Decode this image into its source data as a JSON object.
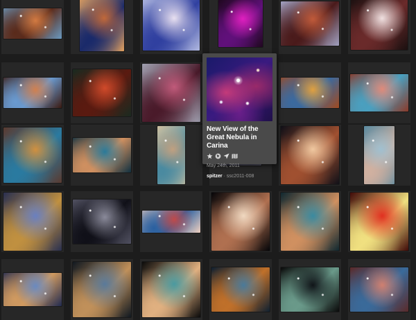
{
  "popup": {
    "title": "New View of the Great Nebula in Carina",
    "date": "May 24th, 2011",
    "source_user": "spitzer",
    "source_sep": " · ",
    "source_id": "ssc2011-008",
    "icons": [
      "star-icon",
      "globe-icon",
      "location-icon",
      "map-icon"
    ]
  },
  "gallery": {
    "rows": [
      [
        {
          "name": "pillars-orange",
          "colors": [
            "#d27a42",
            "#5a2a1a",
            "#6a9ac0"
          ]
        },
        {
          "name": "nebula-cloud-blue-orange",
          "colors": [
            "#c0683a",
            "#1a2a6a",
            "#e0a060"
          ]
        },
        {
          "name": "eta-carinae-blue",
          "colors": [
            "#e8e0f0",
            "#3040a0",
            "#b0b8e0"
          ]
        },
        {
          "name": "magenta-glow",
          "colors": [
            "#e020c0",
            "#60107a",
            "#200820"
          ]
        },
        {
          "name": "orange-dust-field",
          "colors": [
            "#c05a3a",
            "#4a1a1a",
            "#a0a0c0"
          ]
        },
        {
          "name": "bright-nebula-white",
          "colors": [
            "#f0e0e0",
            "#6a2a2a",
            "#1a1010"
          ]
        }
      ],
      [
        {
          "name": "pillars-blue-sky",
          "colors": [
            "#d08050",
            "#6a9ad0",
            "#3a1a10"
          ]
        },
        {
          "name": "red-cloud",
          "colors": [
            "#d04a2a",
            "#5a1a10",
            "#1a2a20"
          ]
        },
        {
          "name": "pink-nebula",
          "colors": [
            "#c05a7a",
            "#4a1a2a",
            "#a0a0b0"
          ]
        },
        {
          "name": "violet-starfield",
          "colors": [
            "#2a2090",
            "#c0306a",
            "#10104a"
          ]
        },
        {
          "name": "golden-wide",
          "colors": [
            "#e0a040",
            "#3a6aa0",
            "#a04a20"
          ]
        },
        {
          "name": "keyhole-pink",
          "colors": [
            "#e08a7a",
            "#4aa0c0",
            "#8a3a2a"
          ]
        }
      ],
      [
        {
          "name": "mystic-mountain",
          "colors": [
            "#d09040",
            "#2a7aa0",
            "#5a3a30"
          ]
        },
        {
          "name": "teal-pillar",
          "colors": [
            "#2a7a9a",
            "#d09060",
            "#103040"
          ]
        },
        {
          "name": "tall-pillar",
          "colors": [
            "#c0a080",
            "#4a8aa0",
            "#d0c0a0"
          ]
        },
        {
          "name": "dim-strip",
          "colors": [
            "#8a8a9a",
            "#3a3a4a",
            "#5a5a6a"
          ]
        },
        {
          "name": "homunculus",
          "colors": [
            "#f0c8a0",
            "#a05030",
            "#101018"
          ]
        },
        {
          "name": "tall-blue-pillar",
          "colors": [
            "#a0c0d0",
            "#d0b0a0",
            "#5a8aa0"
          ]
        }
      ],
      [
        {
          "name": "blue-cluster",
          "colors": [
            "#6a80c0",
            "#c09040",
            "#2a3050"
          ]
        },
        {
          "name": "dark-starfield",
          "colors": [
            "#8a8a9a",
            "#101018",
            "#505060"
          ]
        },
        {
          "name": "red-ridge",
          "colors": [
            "#c04a4a",
            "#2a60a0",
            "#f0d0c0"
          ]
        },
        {
          "name": "homunculus-black",
          "colors": [
            "#f0d8c0",
            "#b07050",
            "#050508"
          ]
        },
        {
          "name": "teal-cluster",
          "colors": [
            "#3a8aa0",
            "#d09060",
            "#102830"
          ]
        },
        {
          "name": "red-explosion",
          "colors": [
            "#e03020",
            "#f0e080",
            "#400a08"
          ]
        }
      ],
      [
        {
          "name": "blue-pillar-low",
          "colors": [
            "#6a8ac0",
            "#d09a60",
            "#202a50"
          ]
        },
        {
          "name": "dusty-filament",
          "colors": [
            "#5a7a9a",
            "#c0905a",
            "#101820"
          ]
        },
        {
          "name": "stepped-mosaic",
          "colors": [
            "#4a9aa0",
            "#e0b080",
            "#0a0a0a"
          ]
        },
        {
          "name": "eagle-nebula",
          "colors": [
            "#4a7a9a",
            "#c0702a",
            "#102030"
          ]
        },
        {
          "name": "single-star",
          "colors": [
            "#101418",
            "#6a9a8a",
            "#0a0a0a"
          ]
        },
        {
          "name": "pink-swirl",
          "colors": [
            "#d08070",
            "#3a6a9a",
            "#5a2a2a"
          ]
        }
      ]
    ]
  }
}
